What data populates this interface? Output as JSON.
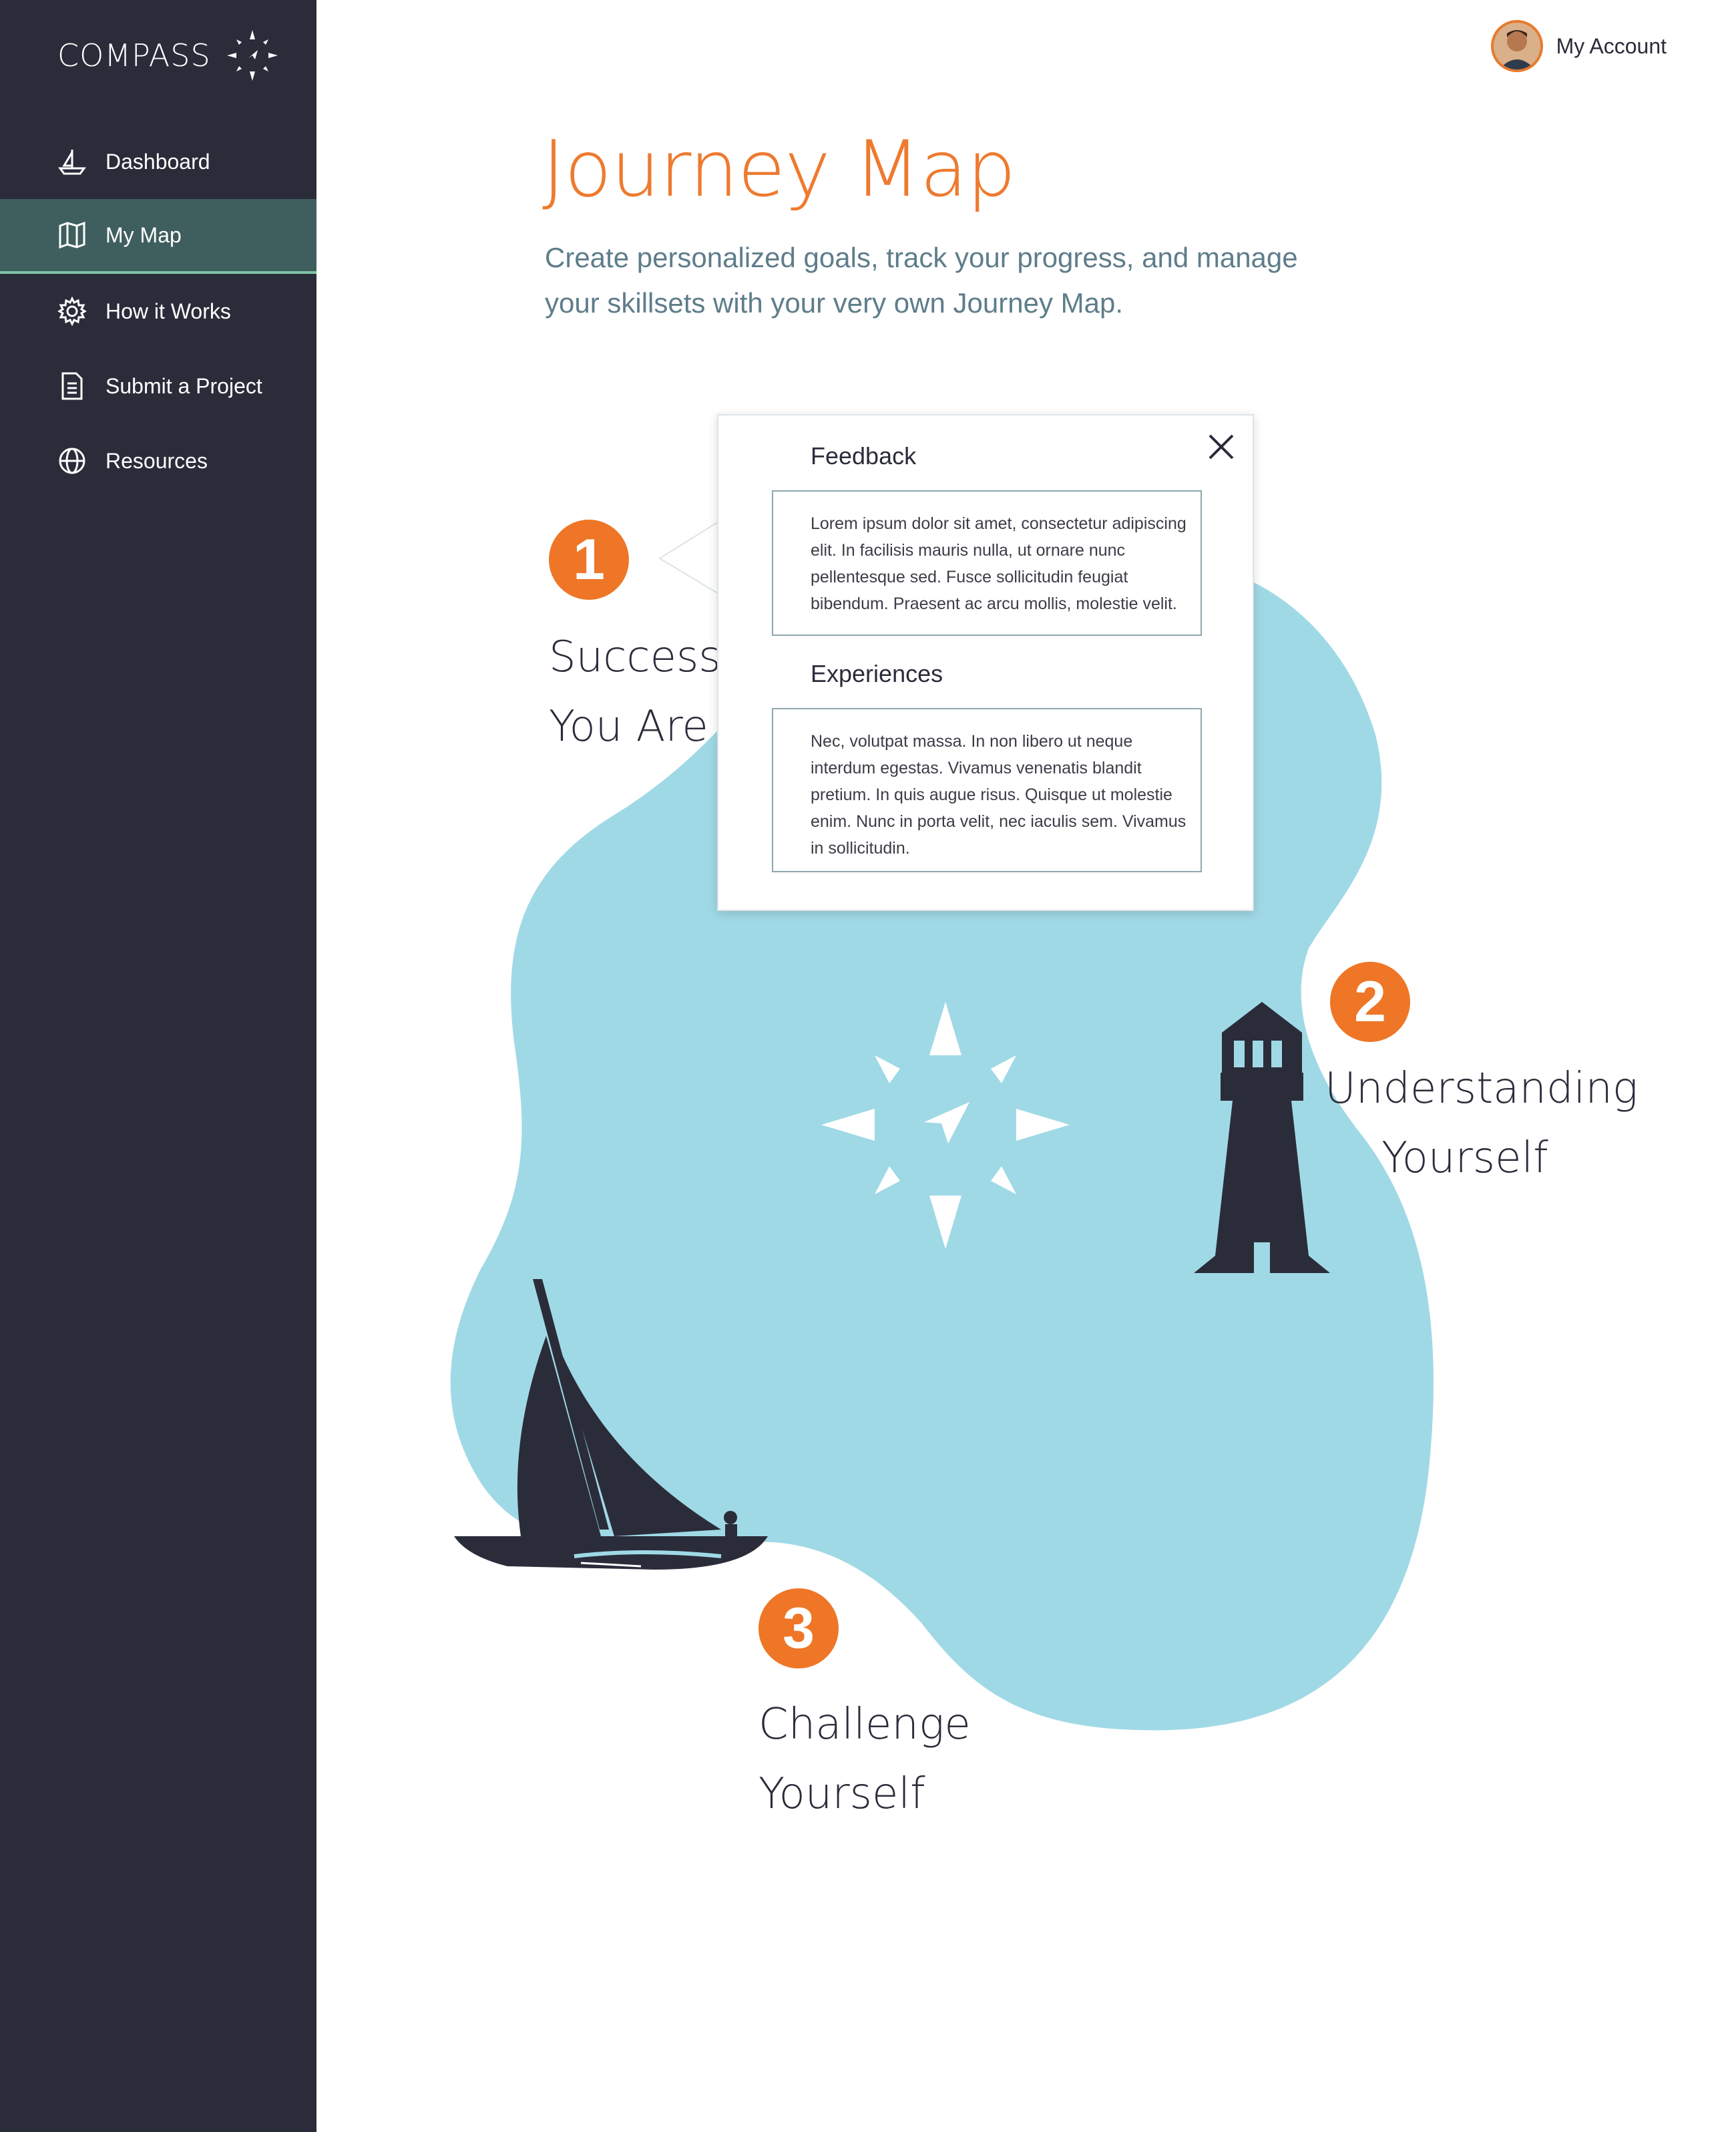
{
  "sidebar": {
    "logo": {
      "text": "COMPASS",
      "icon": "compass-star-icon"
    },
    "items": [
      {
        "label": "Dashboard",
        "icon": "boat-icon",
        "active": false
      },
      {
        "label": "My Map",
        "icon": "map-icon",
        "active": true
      },
      {
        "label": "How it Works",
        "icon": "gear-icon",
        "active": false
      },
      {
        "label": "Submit a Project",
        "icon": "document-icon",
        "active": false
      },
      {
        "label": "Resources",
        "icon": "globe-icon",
        "active": false
      }
    ]
  },
  "header": {
    "account_label": "My Account",
    "avatar_icon": "user-avatar"
  },
  "main": {
    "title": "Journey Map",
    "subtitle": "Create personalized goals, track your progress, and manage your skillsets with your very own Journey Map."
  },
  "map": {
    "steps": [
      {
        "number": "1",
        "line1": "Success W",
        "line2": "You Are"
      },
      {
        "number": "2",
        "line1": "Understanding",
        "line2": "Yourself"
      },
      {
        "number": "3",
        "line1": "Challenge",
        "line2": "Yourself"
      }
    ],
    "illustrations": [
      "compass-rose-icon",
      "lighthouse-icon",
      "sailboat-icon"
    ]
  },
  "popup": {
    "feedback_label": "Feedback",
    "feedback_text": "Lorem ipsum dolor sit amet, consectetur adipiscing elit. In facilisis mauris nulla, ut ornare nunc pellentesque sed. Fusce sollicitudin feugiat bibendum. Praesent ac arcu mollis, molestie velit.",
    "experiences_label": "Experiences",
    "experiences_text": "Nec, volutpat massa. In non libero ut neque interdum egestas. Vivamus venenatis blandit pretium. In quis augue risus. Quisque ut molestie enim. Nunc in porta velit, nec iaculis sem. Vivamus in sollicitudin."
  },
  "colors": {
    "sidebar_bg": "#2b2c3a",
    "active_bg": "#3f5f5e",
    "active_border": "#7fc4a8",
    "accent_orange": "#ee7626",
    "map_blue": "#a0d9e6",
    "subtitle": "#5e7d8a"
  }
}
